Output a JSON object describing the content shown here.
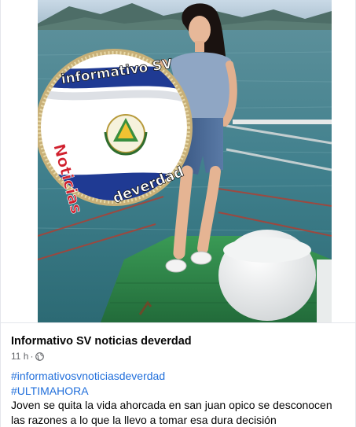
{
  "post": {
    "page_name": "Informativo SV noticias deverdad",
    "time": "11 h",
    "separator": "·",
    "privacy_icon": "globe-icon",
    "hashtags": [
      "#informativosvnoticiasdeverdad",
      "#ULTIMAHORA"
    ],
    "caption": "Joven se quita la vida ahorcada en san juan opico se desconocen las razones a lo que la llevo a tomar esa dura decisión"
  },
  "watermark": {
    "top_text": "informativo SV",
    "left_text": "Noticias",
    "bottom_text": "deverdad"
  },
  "colors": {
    "hashtag": "#216fdb",
    "text": "#050505",
    "secondary": "#65676b",
    "lake": "#3f7f8c",
    "turf": "#2f8a4a",
    "flag_blue": "#1f3a93",
    "logo_red": "#d0202e",
    "gold_ring": "#c8b078"
  }
}
